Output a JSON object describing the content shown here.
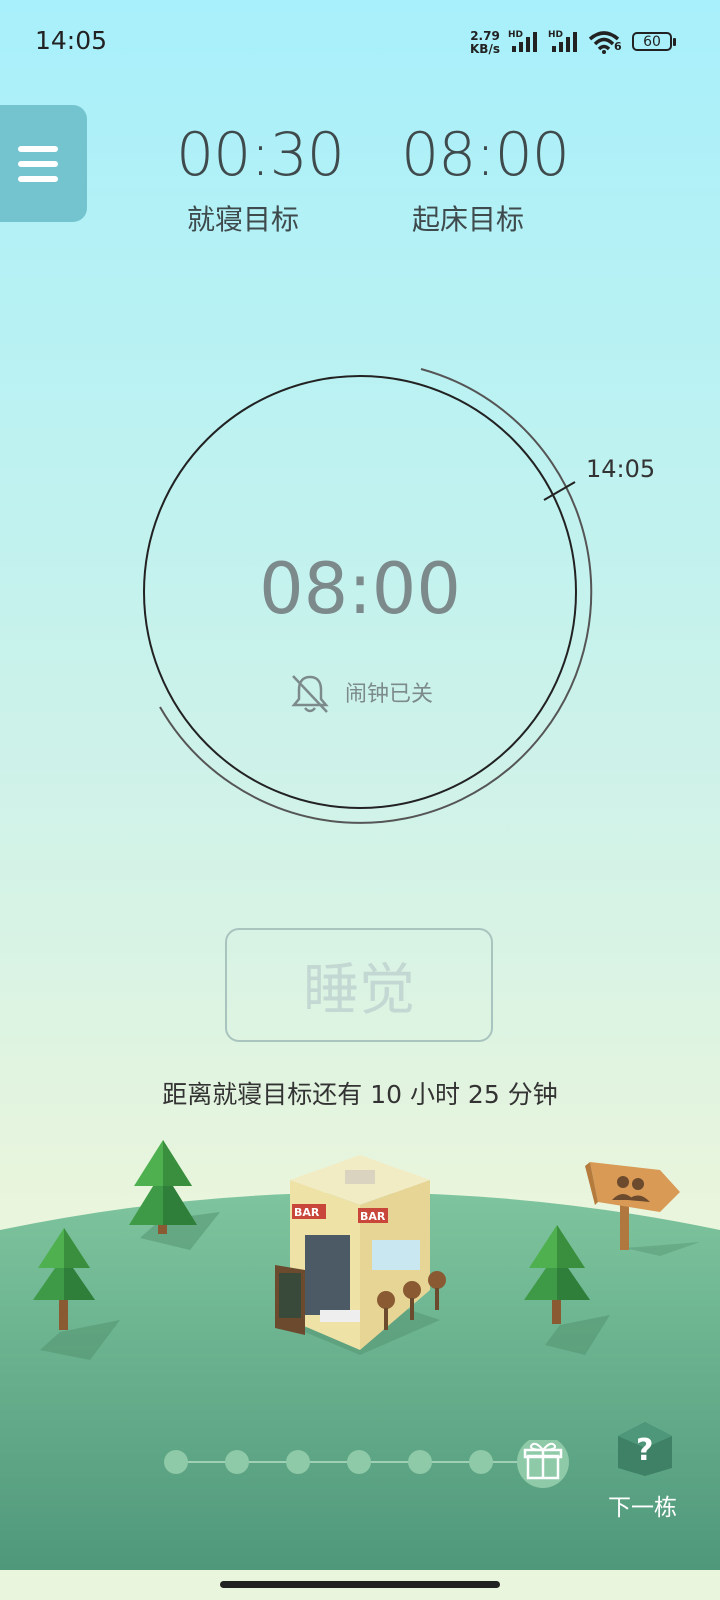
{
  "status_bar": {
    "time": "14:05",
    "net_speed_value": "2.79",
    "net_speed_unit": "KB/s",
    "hd1": "HD",
    "hd2": "HD",
    "wifi_sub": "6",
    "battery": "60"
  },
  "targets": {
    "bedtime": {
      "time": "00:30",
      "label": "就寝目标"
    },
    "wake": {
      "time": "08:00",
      "label": "起床目标"
    }
  },
  "clock": {
    "current_time_marker": "14:05",
    "center_time": "08:00",
    "alarm_status": "闹钟已关"
  },
  "sleep_button": {
    "label": "睡觉"
  },
  "countdown_text": "距离就寝目标还有 10 小时 25 分钟",
  "progress": {
    "total_dots": 6,
    "reward_icon": "gift-icon"
  },
  "next_building": {
    "label": "下一栋",
    "icon": "question-mark-house-icon"
  },
  "scene": {
    "sign_icon": "people-icon",
    "building_signs": [
      "BAR",
      "BAR"
    ]
  },
  "colors": {
    "sky_top": "#a8f0fb",
    "hill_green": "#7ec49e",
    "hill_dark": "#4f987a",
    "menu_bg": "#74c4cf"
  }
}
